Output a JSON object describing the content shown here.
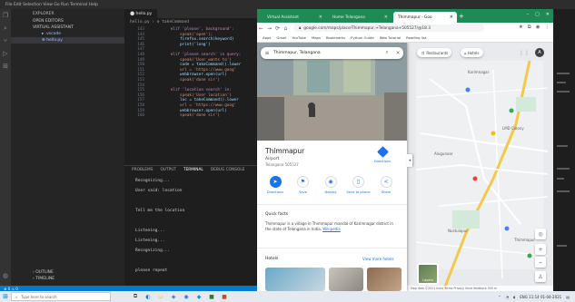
{
  "vscode": {
    "title_menu": "File  Edit  Selection  View  Go  Run  Terminal  Help",
    "window_title": "",
    "activity_icons": [
      "files-icon",
      "search-icon",
      "source-control-icon",
      "run-debug-icon",
      "extensions-icon"
    ],
    "sidebar": {
      "header": "EXPLORER",
      "section": "OPEN EDITORS",
      "project": "VIRTUAL ASSISTANT",
      "items": [
        "▸ .vscode",
        "⊕ hello.py"
      ],
      "footer": [
        "› OUTLINE",
        "› TIMELINE"
      ]
    },
    "tab": "⬤ hello.py",
    "breadcrumb": "hello.py › ⊕ takeCommand",
    "code_lines": [
      {
        "n": "143",
        "t": "        elif 'please', background':",
        "k": "k"
      },
      {
        "n": "144",
        "t": "            speak('open');",
        "k": "s"
      },
      {
        "n": "145",
        "t": "            firefox.search(keyword)",
        "k": ""
      },
      {
        "n": "146",
        "t": "            print('long')",
        "k": ""
      },
      {
        "n": "147",
        "t": "",
        "k": ""
      },
      {
        "n": "148",
        "t": "        elif 'please search' in query:",
        "k": "k"
      },
      {
        "n": "149",
        "t": "            speak('User wants to')",
        "k": "s"
      },
      {
        "n": "150",
        "t": "            code = takeCommand().lower",
        "k": ""
      },
      {
        "n": "151",
        "t": "            url = 'https://www.goog'",
        "k": "s"
      },
      {
        "n": "152",
        "t": "            webbrowser.open(url)",
        "k": ""
      },
      {
        "n": "153",
        "t": "            speak('done sir')",
        "k": "s"
      },
      {
        "n": "154",
        "t": "",
        "k": ""
      },
      {
        "n": "155",
        "t": "        elif 'location search' in:",
        "k": "k"
      },
      {
        "n": "156",
        "t": "            speak('User location')",
        "k": "s"
      },
      {
        "n": "157",
        "t": "            loc = takeCommand().lower",
        "k": ""
      },
      {
        "n": "158",
        "t": "            url = 'https://www.goog'",
        "k": "s"
      },
      {
        "n": "159",
        "t": "            webbrowser.open(url)",
        "k": ""
      },
      {
        "n": "160",
        "t": "            speak('done sir')",
        "k": "s"
      }
    ],
    "panel_tabs": [
      "PROBLEMS",
      "OUTPUT",
      "TERMINAL",
      "DEBUG CONSOLE"
    ],
    "terminal_lines": [
      "Recognizing...",
      "User said: location",
      "",
      "Tell me the location",
      "",
      "Listening...",
      "Listening...",
      "Recognizing...",
      "",
      "please repeat",
      "",
      "done sir"
    ],
    "status": "⊗ 0 ⚠ 0"
  },
  "chrome": {
    "tabs": [
      "Virtual Assistant",
      "Home Telangana",
      "Thimmapur - Goo"
    ],
    "url": "google.com/maps/place/Thimmapur,+Telangana+505527/@18.3",
    "bookmarks": [
      "Apps",
      "Gmail",
      "YouTube",
      "Maps",
      "Bookmarks",
      "Python Guide",
      "Web Tutorial",
      "Reading list"
    ]
  },
  "maps": {
    "search_value": "Thimmapur, Telangana",
    "place_title": "Thimmapur",
    "place_subtitle": "Airport",
    "place_address": "Telangana 505527",
    "directions_label": "Directions",
    "actions": [
      {
        "icon": "directions-icon",
        "label": "Directions"
      },
      {
        "icon": "save-icon",
        "label": "Save"
      },
      {
        "icon": "nearby-icon",
        "label": "Nearby"
      },
      {
        "icon": "send-to-phone-icon",
        "label": "Send to phone"
      },
      {
        "icon": "share-icon",
        "label": "Share"
      }
    ],
    "about_heading": "Quick facts",
    "about_text": "Thimmapur is a village in Thimmapur mandal of Karimnagar district in the state of Telangana in India.",
    "about_link": "Wikipedia",
    "hotels_heading": "Hotels",
    "hotels_more": "View more hotels",
    "chips": [
      "Restaurants",
      "Hotels"
    ],
    "layers_label": "Layers",
    "labels": [
      {
        "t": "Karimnagar",
        "x": 0,
        "y": 0
      },
      {
        "t": "LMD Colony"
      },
      {
        "t": "Alugunoor"
      },
      {
        "t": "Thimmapur"
      },
      {
        "t": "Nustulapur"
      }
    ],
    "footer": "Map data ©2021  India  Terms  Privacy  Send feedback  500 m"
  },
  "taskbar": {
    "search_placeholder": "Type here to search",
    "tray": "ENG  11:14  01-04-2021"
  }
}
